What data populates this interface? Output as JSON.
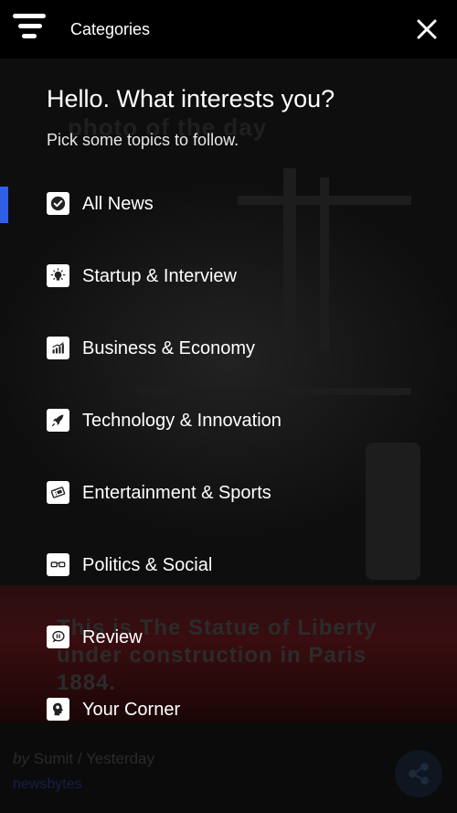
{
  "header": {
    "title": "Categories",
    "menu_icon": "menu-icon",
    "close_icon": "close-icon"
  },
  "drawer": {
    "greeting": "Hello. What interests you?",
    "subtitle": "Pick some topics to follow.",
    "accent_color": "#2f5fe6",
    "topics": [
      {
        "label": "All News",
        "icon": "check-icon",
        "selected": true
      },
      {
        "label": "Startup & Interview",
        "icon": "lightbulb-icon",
        "selected": false
      },
      {
        "label": "Business & Economy",
        "icon": "bar-chart-icon",
        "selected": false
      },
      {
        "label": "Technology & Innovation",
        "icon": "rocket-icon",
        "selected": false
      },
      {
        "label": "Entertainment & Sports",
        "icon": "ticket-icon",
        "selected": false
      },
      {
        "label": "Politics & Social",
        "icon": "glasses-icon",
        "selected": false
      },
      {
        "label": "Review",
        "icon": "speech-bubble-icon",
        "selected": false
      },
      {
        "label": "Your Corner",
        "icon": "head-idea-icon",
        "selected": false
      }
    ]
  },
  "background": {
    "photo_label": "photo of the day",
    "caption": "This is The Statue of Liberty under construction in Paris 1884.",
    "byline_prefix": "by",
    "byline_rest": " Sumit / Yesterday",
    "source": "newsbytes",
    "share_icon": "share-icon"
  }
}
